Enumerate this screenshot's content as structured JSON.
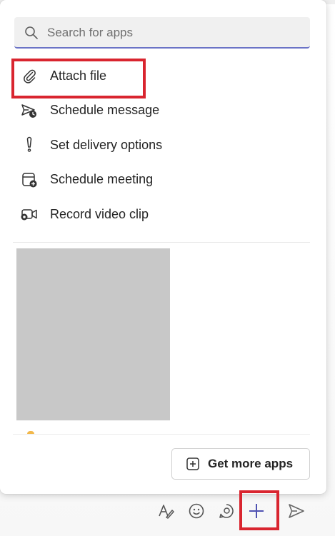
{
  "search": {
    "placeholder": "Search for apps"
  },
  "menu": {
    "items": [
      {
        "label": "Attach file",
        "icon": "paperclip-icon"
      },
      {
        "label": "Schedule message",
        "icon": "send-clock-icon"
      },
      {
        "label": "Set delivery options",
        "icon": "exclamation-icon"
      },
      {
        "label": "Schedule meeting",
        "icon": "calendar-add-icon"
      },
      {
        "label": "Record video clip",
        "icon": "video-record-icon"
      }
    ]
  },
  "footer": {
    "get_more_apps_label": "Get more apps"
  },
  "toolbar": {
    "buttons": [
      "format-icon",
      "emoji-icon",
      "loop-icon",
      "plus-icon",
      "send-icon"
    ]
  },
  "colors": {
    "highlight": "#d9252f",
    "accent": "#6b73c6",
    "plus": "#4f52b2"
  }
}
